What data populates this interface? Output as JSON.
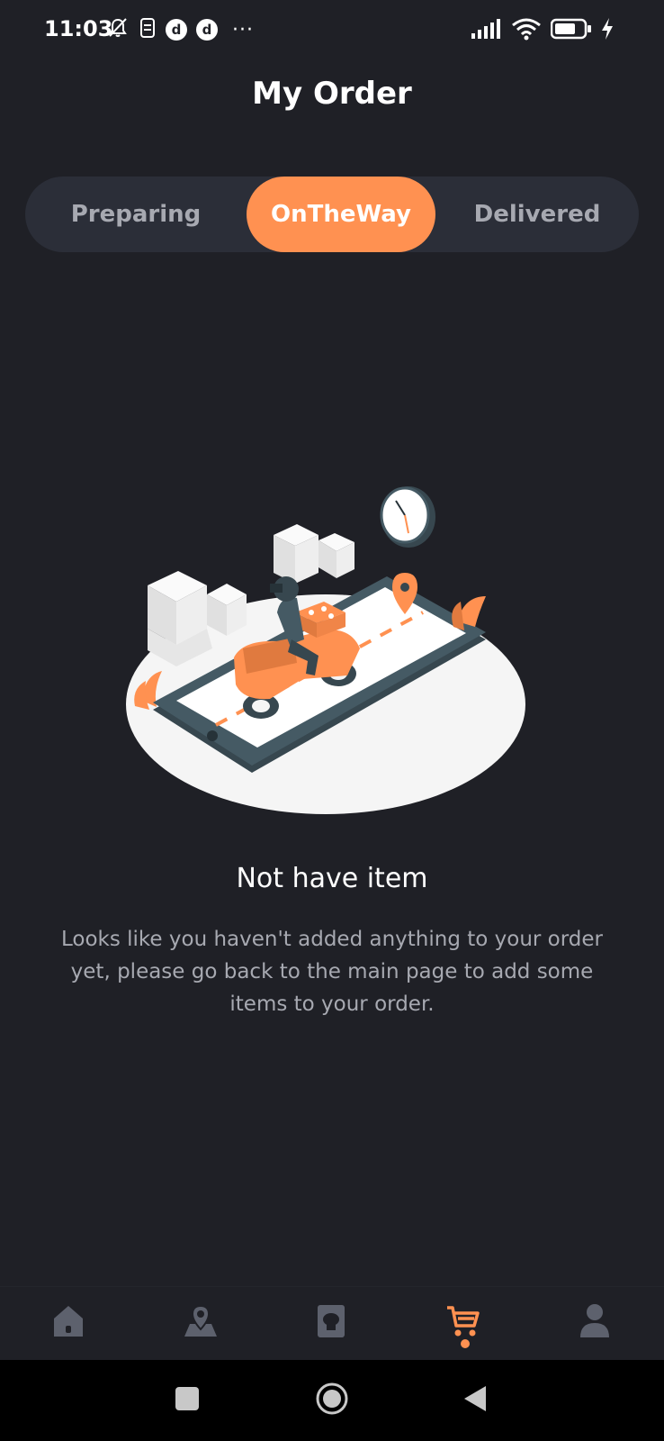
{
  "status_bar": {
    "time": "11:03",
    "left_icons": [
      "bell-off-icon",
      "sim-icon",
      "d-app-icon",
      "d-app-icon"
    ],
    "d_label": "d",
    "overflow": "···",
    "right_icons": [
      "signal-icon",
      "wifi-icon",
      "battery-icon",
      "charging-icon"
    ]
  },
  "header": {
    "title": "My Order"
  },
  "tabs": [
    {
      "label": "Preparing",
      "active": false
    },
    {
      "label": "OnTheWay",
      "active": true
    },
    {
      "label": "Delivered",
      "active": false
    }
  ],
  "empty_state": {
    "title": "Not have item",
    "description": "Looks like you haven't added anything to your order yet, please go back to the main page to add some items to your order."
  },
  "bottom_nav": {
    "items": [
      {
        "icon": "home-icon",
        "active": false
      },
      {
        "icon": "map-pin-icon",
        "active": false
      },
      {
        "icon": "menu-book-icon",
        "active": false
      },
      {
        "icon": "cart-icon",
        "active": true
      },
      {
        "icon": "profile-icon",
        "active": false
      }
    ]
  },
  "colors": {
    "background": "#1f2026",
    "accent": "#ff9151",
    "tab_bar": "#2b2e38",
    "muted_text": "#a7a9b1",
    "nav_icon": "#5d616d"
  }
}
